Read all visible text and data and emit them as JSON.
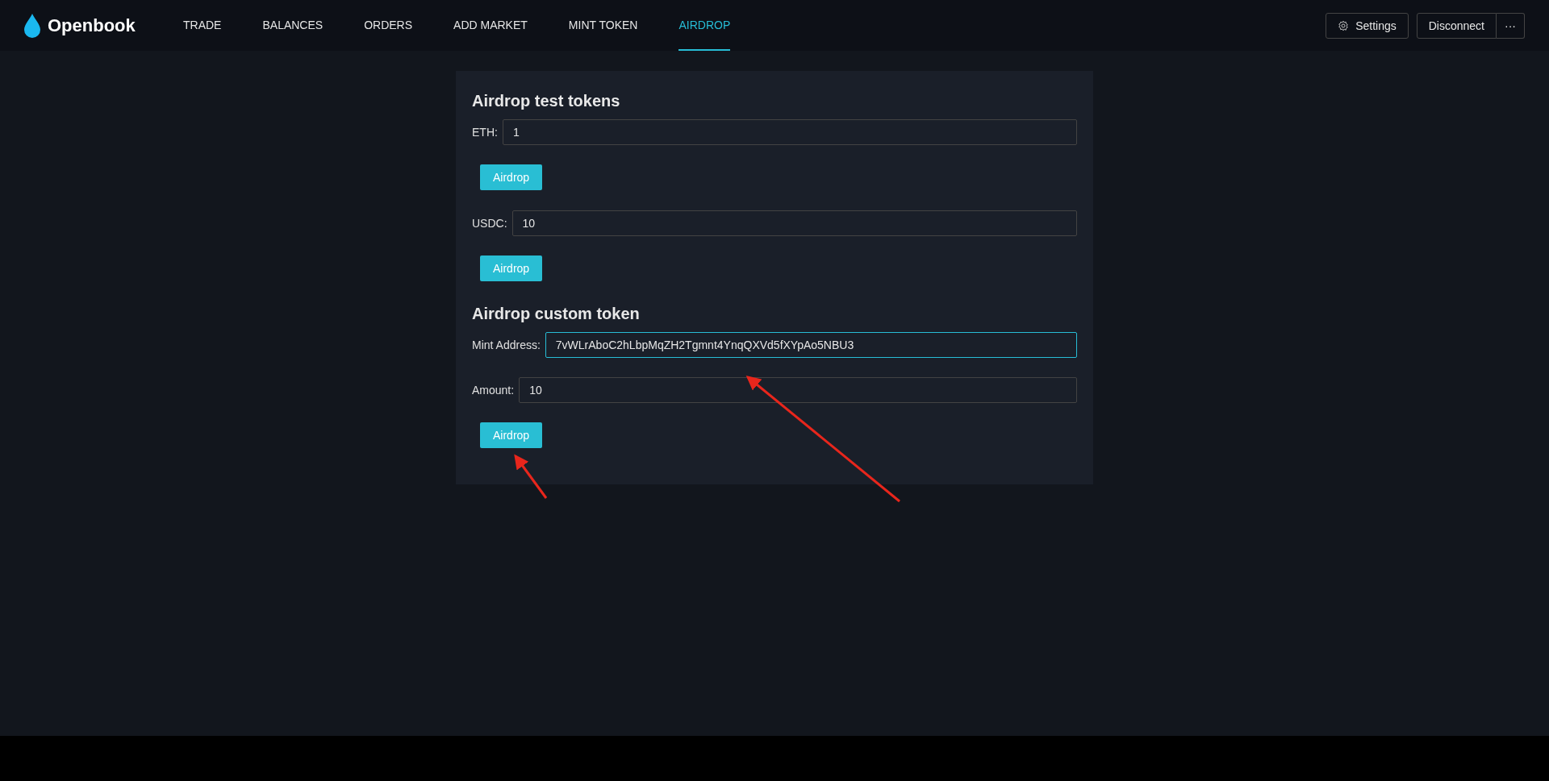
{
  "header": {
    "logo": "Openbook",
    "nav": [
      {
        "label": "TRADE",
        "selected": false
      },
      {
        "label": "BALANCES",
        "selected": false
      },
      {
        "label": "ORDERS",
        "selected": false
      },
      {
        "label": "ADD MARKET",
        "selected": false
      },
      {
        "label": "MINT TOKEN",
        "selected": false
      },
      {
        "label": "AIRDROP",
        "selected": true
      }
    ],
    "settings_button": "Settings",
    "disconnect_button": "Disconnect",
    "more_button": "···"
  },
  "sections": [
    {
      "title": "Airdrop test tokens",
      "groups": [
        {
          "fields": [
            {
              "label": "ETH:",
              "value": "1",
              "focused": false,
              "arrow": false
            }
          ],
          "button": "Airdrop",
          "button_arrow": false
        },
        {
          "fields": [
            {
              "label": "USDC:",
              "value": "10",
              "focused": false,
              "arrow": false
            }
          ],
          "button": "Airdrop",
          "button_arrow": false
        }
      ]
    },
    {
      "title": "Airdrop custom token",
      "groups": [
        {
          "fields": [
            {
              "label": "Mint Address:",
              "value": "7vWLrAboC2hLbpMqZH2Tgmnt4YnqQXVd5fXYpAo5NBU3",
              "focused": true,
              "arrow": true
            },
            {
              "label": "Amount:",
              "value": "10",
              "focused": false,
              "arrow": false
            }
          ],
          "button": "Airdrop",
          "button_arrow": true
        }
      ]
    }
  ]
}
